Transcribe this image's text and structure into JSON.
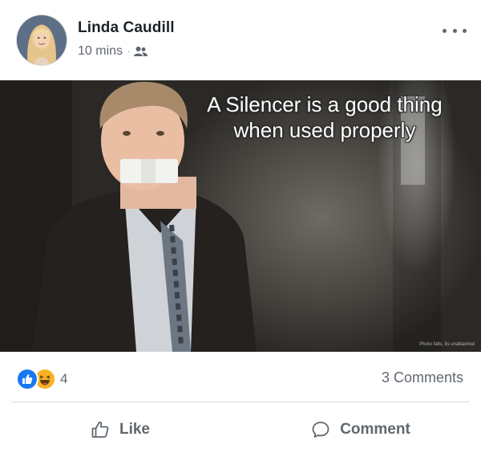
{
  "post": {
    "author_name": "Linda Caudill",
    "timestamp": "10 mins",
    "separator": "·",
    "audience_icon": "friends-icon",
    "more_icon": "more-options-icon"
  },
  "photo": {
    "caption_line1": "A Silencer is a good thing",
    "caption_line2": "when used properly",
    "watermark": "Photo falls, its unattached"
  },
  "reactions": {
    "icons": [
      "like-reaction-icon",
      "haha-reaction-icon"
    ],
    "count": "4",
    "comments": "3 Comments"
  },
  "actions": {
    "like_label": "Like",
    "comment_label": "Comment"
  },
  "colors": {
    "like_blue": "#1877f2",
    "haha_yellow": "#f7b125",
    "secondary_text": "#616770",
    "divider": "#dadde1"
  }
}
